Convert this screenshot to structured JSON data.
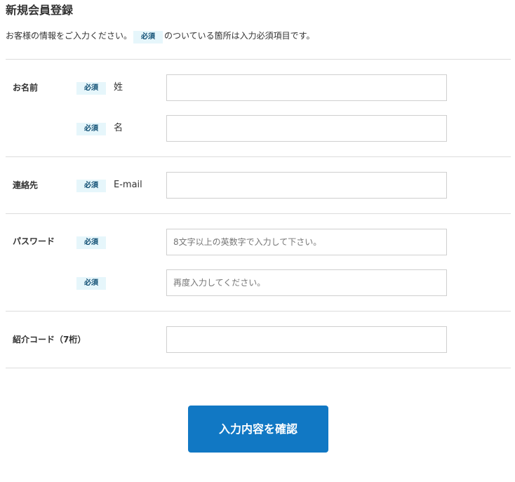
{
  "page": {
    "title": "新規会員登録",
    "intro_before": "お客様の情報をご入力ください。",
    "intro_badge": "必須",
    "intro_after": "のついている箇所は入力必須項目です。"
  },
  "required_badge": "必須",
  "sections": {
    "name": {
      "label": "お名前",
      "last_name_label": "姓",
      "last_name_value": "",
      "last_name_placeholder": "",
      "first_name_label": "名",
      "first_name_value": "",
      "first_name_placeholder": ""
    },
    "contact": {
      "label": "連絡先",
      "email_label": "E-mail",
      "email_value": "",
      "email_placeholder": ""
    },
    "password": {
      "label": "パスワード",
      "password_placeholder": "8文字以上の英数字で入力して下さい。",
      "confirm_placeholder": "再度入力してください。"
    },
    "referral": {
      "label": "紹介コード（7桁）",
      "code_value": "",
      "code_placeholder": ""
    }
  },
  "submit_label": "入力内容を確認",
  "colors": {
    "badge_bg": "#e6f6fb",
    "badge_text": "#0f4e73",
    "button_bg": "#1178c4",
    "divider": "#dcdcdc"
  }
}
